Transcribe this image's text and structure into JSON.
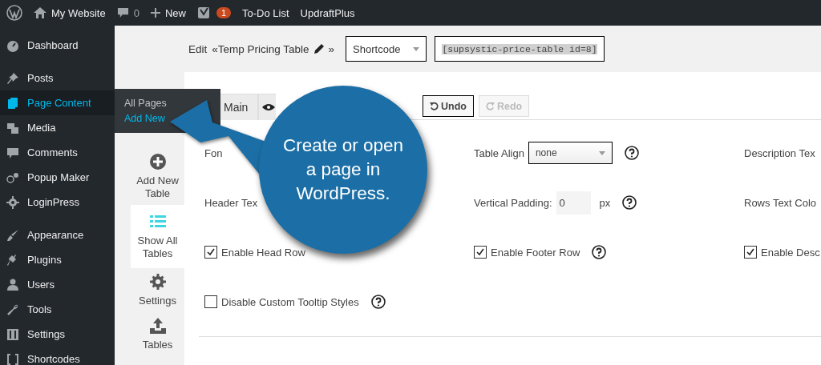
{
  "admin_bar": {
    "site": "My Website",
    "comments": "0",
    "new": "New",
    "notifications": "1",
    "links": [
      "To-Do List",
      "UpdraftPlus"
    ]
  },
  "sidebar": {
    "groups": [
      [
        {
          "label": "Dashboard",
          "selected": false
        }
      ],
      [
        {
          "label": "Posts",
          "selected": false
        },
        {
          "label": "Page Content",
          "selected": true
        },
        {
          "label": "Media",
          "selected": false
        },
        {
          "label": "Comments",
          "selected": false
        },
        {
          "label": "Popup Maker",
          "selected": false
        },
        {
          "label": "LoginPress",
          "selected": false
        }
      ],
      [
        {
          "label": "Appearance",
          "selected": false
        },
        {
          "label": "Plugins",
          "selected": false
        },
        {
          "label": "Users",
          "selected": false
        },
        {
          "label": "Tools",
          "selected": false
        },
        {
          "label": "Settings",
          "selected": false
        },
        {
          "label": "Shortcodes",
          "selected": false
        }
      ]
    ]
  },
  "flyout": {
    "items": [
      {
        "label": "All Pages",
        "selected": false
      },
      {
        "label": "Add New",
        "selected": true
      }
    ]
  },
  "header": {
    "edit": "Edit",
    "title": "«Temp Pricing Table",
    "close": "»",
    "mode_select": "Shortcode",
    "shortcode": "[supsystic-price-table id=8]"
  },
  "plugin_nav": [
    {
      "label": "Add New Table",
      "selected": false
    },
    {
      "label": "Show All Tables",
      "selected": true
    },
    {
      "label": "Settings",
      "selected": false
    },
    {
      "label": "Tables",
      "selected": false
    }
  ],
  "tabs": [
    {
      "kind": "text",
      "label": "Main"
    },
    {
      "kind": "icon"
    }
  ],
  "toolbar": [
    {
      "label": "Undo",
      "disabled": false
    },
    {
      "label": "Redo",
      "disabled": true
    }
  ],
  "form": {
    "columns": [
      [
        {
          "kind": "label",
          "label": "Fon"
        },
        {
          "kind": "label",
          "label": "Header Tex"
        },
        {
          "kind": "checkbox",
          "label": "Enable Head Row",
          "checked": true,
          "help": false
        },
        {
          "kind": "checkbox",
          "label": "Disable Custom Tooltip Styles",
          "checked": false,
          "help": true
        }
      ],
      [
        {
          "kind": "select",
          "label": "Table Align",
          "value": "none",
          "help": true
        },
        {
          "kind": "number",
          "label": "Vertical Padding:",
          "value": "0",
          "unit": "px",
          "help": true
        },
        {
          "kind": "checkbox",
          "label": "Enable Footer Row",
          "checked": true,
          "help": true
        },
        {
          "kind": "empty"
        }
      ],
      [
        {
          "kind": "label",
          "label": "Description Tex"
        },
        {
          "kind": "label",
          "label": "Rows Text Colo"
        },
        {
          "kind": "checkbox",
          "label": "Enable Desc",
          "checked": true,
          "help": false
        },
        {
          "kind": "empty"
        }
      ]
    ]
  },
  "callout": {
    "text": "Create or open\na page in\nWordPress."
  }
}
